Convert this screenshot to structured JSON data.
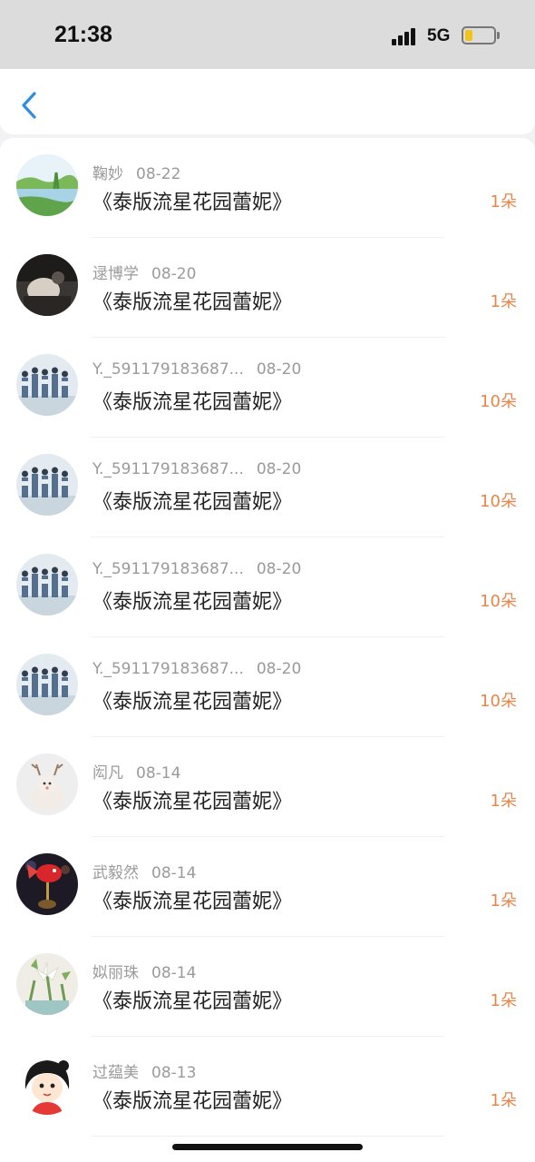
{
  "status": {
    "time": "21:38",
    "network": "5G",
    "battery_level": 0.25
  },
  "nav": {
    "back_icon": "chevron-left-icon",
    "accent_color": "#2f8ee0"
  },
  "count_color": "#e8854a",
  "rows": [
    {
      "name": "鞠妙",
      "date": "08-22",
      "title": "《泰版流星花园蕾妮》",
      "count": "1朵",
      "avatar": "lake-landscape"
    },
    {
      "name": "逯博学",
      "date": "08-20",
      "title": "《泰版流星花园蕾妮》",
      "count": "1朵",
      "avatar": "dark-photo"
    },
    {
      "name": "Y._591179183687...",
      "date": "08-20",
      "title": "《泰版流星花园蕾妮》",
      "count": "10朵",
      "avatar": "group-photo"
    },
    {
      "name": "Y._591179183687...",
      "date": "08-20",
      "title": "《泰版流星花园蕾妮》",
      "count": "10朵",
      "avatar": "group-photo"
    },
    {
      "name": "Y._591179183687...",
      "date": "08-20",
      "title": "《泰版流星花园蕾妮》",
      "count": "10朵",
      "avatar": "group-photo"
    },
    {
      "name": "Y._591179183687...",
      "date": "08-20",
      "title": "《泰版流星花园蕾妮》",
      "count": "10朵",
      "avatar": "group-photo"
    },
    {
      "name": "闳凡",
      "date": "08-14",
      "title": "《泰版流星花园蕾妮》",
      "count": "1朵",
      "avatar": "deer-toy"
    },
    {
      "name": "武毅然",
      "date": "08-14",
      "title": "《泰版流星花园蕾妮》",
      "count": "1朵",
      "avatar": "red-goldfish"
    },
    {
      "name": "姒丽珠",
      "date": "08-14",
      "title": "《泰版流星花园蕾妮》",
      "count": "1朵",
      "avatar": "white-lily"
    },
    {
      "name": "过蕴美",
      "date": "08-13",
      "title": "《泰版流星花园蕾妮》",
      "count": "1朵",
      "avatar": "cartoon-girl"
    }
  ]
}
